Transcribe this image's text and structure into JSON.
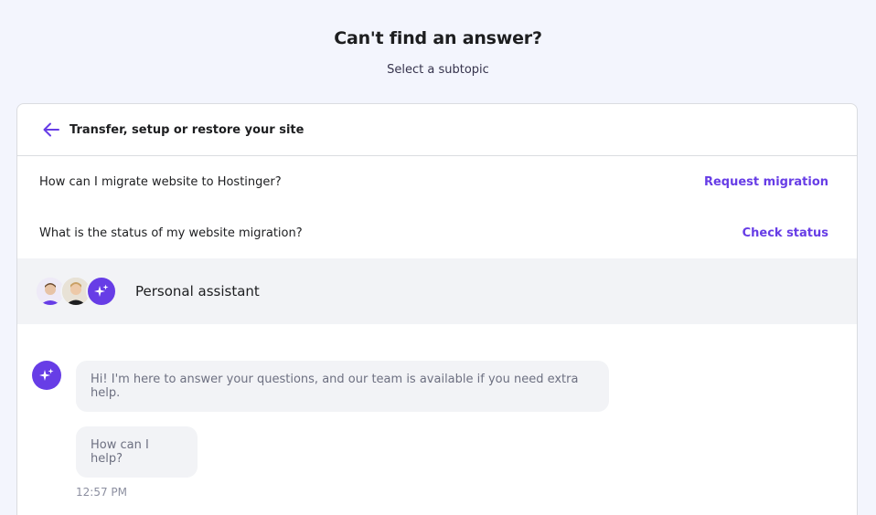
{
  "page": {
    "title": "Can't find an answer?",
    "subtitle": "Select a subtopic"
  },
  "card": {
    "header_title": "Transfer, setup or restore your site",
    "rows": [
      {
        "question": "How can I migrate website to Hostinger?",
        "action": "Request migration"
      },
      {
        "question": "What is the status of my website migration?",
        "action": "Check status"
      }
    ]
  },
  "assistant": {
    "name": "Personal assistant"
  },
  "chat": {
    "messages": [
      {
        "text": "Hi! I'm here to answer your questions, and our team is available if you need extra help."
      },
      {
        "text": "How can I help?"
      }
    ],
    "timestamp": "12:57 PM"
  },
  "colors": {
    "accent": "#673de6",
    "background": "#f3f5fd",
    "bubble": "#f2f3f6"
  },
  "icons": {
    "back": "arrow-left-icon",
    "assistant": "sparkles-icon"
  }
}
